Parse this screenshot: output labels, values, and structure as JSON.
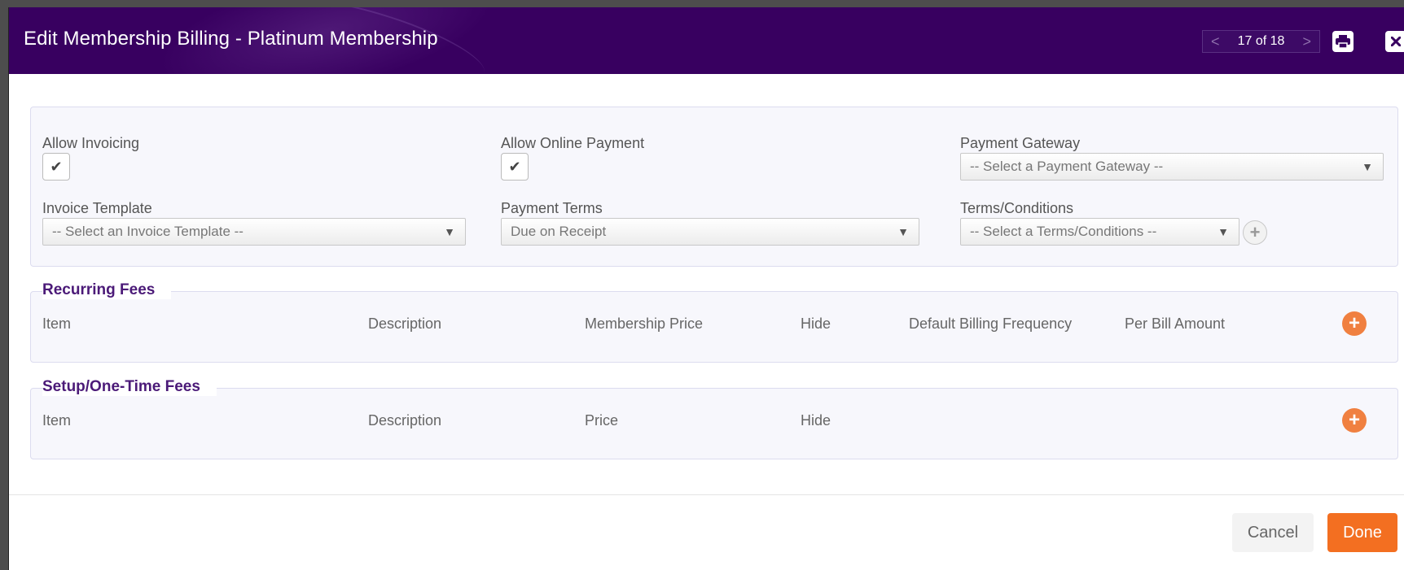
{
  "modal": {
    "title": "Edit Membership Billing - Platinum Membership",
    "pager": {
      "prev": "<",
      "label": "17 of 18",
      "next": ">"
    },
    "print_icon": "print-icon",
    "close_icon": "close-icon"
  },
  "billing": {
    "allow_invoicing": {
      "label": "Allow Invoicing",
      "checked": true
    },
    "allow_online_payment": {
      "label": "Allow Online Payment",
      "checked": true
    },
    "payment_gateway": {
      "label": "Payment Gateway",
      "value": "-- Select a Payment Gateway --"
    },
    "invoice_template": {
      "label": "Invoice Template",
      "value": "-- Select an Invoice Template --"
    },
    "payment_terms": {
      "label": "Payment Terms",
      "value": "Due on Receipt"
    },
    "terms_conditions": {
      "label": "Terms/Conditions",
      "value": "-- Select a Terms/Conditions --"
    },
    "check_mark": "✔",
    "caret": "▼",
    "plus": "+"
  },
  "recurring_fees": {
    "title": "Recurring Fees",
    "columns": [
      "Item",
      "Description",
      "Membership Price",
      "Hide",
      "Default Billing Frequency",
      "Per Bill Amount"
    ]
  },
  "setup_fees": {
    "title": "Setup/One-Time Fees",
    "columns": [
      "Item",
      "Description",
      "Price",
      "Hide"
    ]
  },
  "footer": {
    "cancel_label": "Cancel",
    "done_label": "Done"
  },
  "colors": {
    "header_bg": "#380060",
    "accent_orange": "#f36f21",
    "legend_purple": "#4b1a78"
  }
}
